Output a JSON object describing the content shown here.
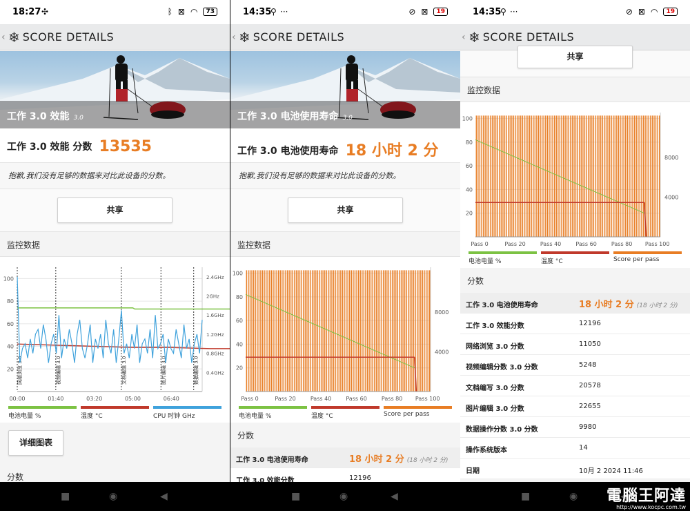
{
  "panels": [
    {
      "status": {
        "time": "18:27",
        "battery": "73"
      },
      "title": "SCORE DETAILS",
      "hero_caption": "工作 3.0 效能",
      "hero_version": "3.0",
      "score_label": "工作 3.0 效能 分数",
      "score_value": "13535",
      "notice": "抱歉,我们没有足够的数据来对比此设备的分数。",
      "share_label": "共享",
      "monitor_label": "监控数据",
      "legend": [
        "电池电量 %",
        "温度 °C",
        "CPU 时钟 GHz"
      ],
      "detail_label": "详细图表",
      "scores_label": "分数"
    },
    {
      "status": {
        "time": "14:35",
        "battery": "19"
      },
      "title": "SCORE DETAILS",
      "hero_caption": "工作 3.0 电池使用寿命",
      "hero_version": "3.0",
      "score_label": "工作 3.0 电池使用寿命",
      "score_value": "18 小时 2 分",
      "notice": "抱歉,我们没有足够的数据来对比此设备的分数。",
      "share_label": "共享",
      "monitor_label": "监控数据",
      "legend": [
        "电池电量 %",
        "温度 °C",
        "Score per pass"
      ],
      "scores_label": "分数",
      "score_rows": [
        {
          "k": "工作 3.0 电池使用寿命",
          "v": "18 小时 2 分",
          "sub": "(18 小时 2 分)"
        },
        {
          "k": "工作 3.0 效能分数",
          "v": "12196"
        }
      ]
    },
    {
      "status": {
        "time": "14:35",
        "battery": "19"
      },
      "title": "SCORE DETAILS",
      "share_label": "共享",
      "monitor_label": "监控数据",
      "legend": [
        "电池电量 %",
        "温度 °C",
        "Score per pass"
      ],
      "scores_label": "分数",
      "score_rows": [
        {
          "k": "工作 3.0 电池使用寿命",
          "v": "18 小时 2 分",
          "sub": "(18 小时 2 分)"
        },
        {
          "k": "工作 3.0 效能分数",
          "v": "12196"
        },
        {
          "k": "网络浏览 3.0 分数",
          "v": "11050"
        },
        {
          "k": "视频编辑分数 3.0 分数",
          "v": "5248"
        },
        {
          "k": "文档编写 3.0 分数",
          "v": "20578"
        },
        {
          "k": "图片编辑 3.0 分数",
          "v": "22655"
        },
        {
          "k": "数据操作分数 3.0 分数",
          "v": "9980"
        },
        {
          "k": "操作系统版本",
          "v": "14"
        },
        {
          "k": "日期",
          "v": "10月 2 2024 11:46"
        }
      ]
    }
  ],
  "watermark": {
    "text": "電腦王阿達",
    "url": "http://www.kocpc.com.tw"
  },
  "colors": {
    "battery": "#7cc243",
    "temp": "#c0392b",
    "clock": "#3fa2dc",
    "score": "#e87d24"
  },
  "chart_data": [
    {
      "type": "line",
      "title": "",
      "y_left": {
        "ticks": [
          20,
          40,
          60,
          80,
          100
        ],
        "range": [
          0,
          110
        ]
      },
      "y_right": {
        "ticks": [
          "0.4GHz",
          "0.8GHz",
          "1.2GHz",
          "1.6GHz",
          "2GHz",
          "2.4GHz"
        ],
        "range": [
          0,
          2.6
        ]
      },
      "x_ticks": [
        "00:00",
        "01:40",
        "03:20",
        "05:00",
        "06:40"
      ],
      "x_range": [
        0,
        480
      ],
      "markers": [
        {
          "t": 0,
          "label": "网络浏览 3.0"
        },
        {
          "t": 100,
          "label": "视频编辑 3.0"
        },
        {
          "t": 270,
          "label": "文档编辑 3.0"
        },
        {
          "t": 373,
          "label": "图片编辑 3.0"
        },
        {
          "t": 458,
          "label": "数据编辑 3.0"
        }
      ],
      "series": [
        {
          "name": "电池电量 %",
          "axis": "left",
          "points": [
            [
              0,
              74
            ],
            [
              300,
              74
            ],
            [
              305,
              73
            ],
            [
              740,
              73
            ]
          ]
        },
        {
          "name": "温度 °C",
          "axis": "left",
          "points": [
            [
              0,
              42
            ],
            [
              100,
              41
            ],
            [
              200,
              40
            ],
            [
              300,
              39
            ],
            [
              400,
              39
            ],
            [
              500,
              38
            ],
            [
              600,
              38
            ],
            [
              740,
              38
            ]
          ]
        },
        {
          "name": "CPU 时钟 GHz",
          "axis": "right",
          "values_ghz": [
            2.4,
            0.6,
            0.9,
            1.0,
            0.7,
            1.1,
            0.8,
            1.2,
            1.3,
            0.9,
            1.4,
            1.1,
            0.6,
            1.0,
            1.2,
            0.8,
            1.6,
            0.7,
            1.1,
            0.9,
            1.3,
            1.0,
            0.6,
            1.2,
            1.5,
            0.9,
            0.7,
            1.0,
            1.4,
            0.6,
            1.1,
            0.9,
            1.2,
            0.7,
            1.5,
            1.0,
            0.8,
            1.3,
            0.6,
            1.1,
            1.7,
            0.8,
            1.0,
            0.7,
            1.2,
            0.9,
            1.4,
            0.6,
            1.0,
            1.1,
            0.8,
            1.3,
            0.7,
            1.6,
            0.9,
            1.0,
            1.2,
            0.6,
            1.1,
            0.9,
            0.8,
            1.3,
            1.0,
            0.7,
            1.4,
            0.9,
            1.1,
            0.6,
            1.0,
            1.2,
            0.8,
            1.5
          ]
        }
      ]
    },
    {
      "type": "bar",
      "title": "",
      "y_left": {
        "ticks": [
          20,
          40,
          60,
          80,
          100
        ],
        "range": [
          0,
          105
        ]
      },
      "y_right": {
        "ticks": [
          4000,
          8000
        ],
        "range": [
          0,
          12500
        ]
      },
      "x_ticks": [
        "Pass 0",
        "Pass 20",
        "Pass 40",
        "Pass 60",
        "Pass 80",
        "Pass 100"
      ],
      "passes": 104,
      "score_per_pass": 12196,
      "series": [
        {
          "name": "电池电量 %",
          "start": 82,
          "end": 20,
          "end_pass": 95
        },
        {
          "name": "温度 °C",
          "value": 29
        },
        {
          "name": "Score per pass",
          "value": 12196
        }
      ]
    },
    {
      "type": "bar",
      "title": "",
      "y_left": {
        "ticks": [
          20,
          40,
          60,
          80,
          100
        ],
        "range": [
          0,
          105
        ]
      },
      "y_right": {
        "ticks": [
          4000,
          8000
        ],
        "range": [
          0,
          12500
        ]
      },
      "x_ticks": [
        "Pass 0",
        "Pass 20",
        "Pass 40",
        "Pass 60",
        "Pass 80",
        "Pass 100"
      ],
      "passes": 104,
      "score_per_pass": 12196,
      "series": [
        {
          "name": "电池电量 %",
          "start": 82,
          "end": 20,
          "end_pass": 95
        },
        {
          "name": "温度 °C",
          "value": 29
        },
        {
          "name": "Score per pass",
          "value": 12196
        }
      ]
    }
  ]
}
